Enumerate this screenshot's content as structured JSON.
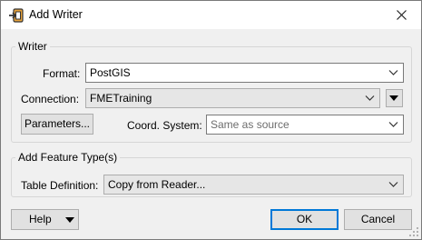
{
  "window": {
    "title": "Add Writer"
  },
  "writer_group": {
    "legend": "Writer",
    "format_label": "Format:",
    "format_value": "PostGIS",
    "connection_label": "Connection:",
    "connection_value": "FMETraining",
    "parameters_button": "Parameters...",
    "coord_label": "Coord. System:",
    "coord_value": "Same as source"
  },
  "feature_group": {
    "legend": "Add Feature Type(s)",
    "table_def_label": "Table Definition:",
    "table_def_value": "Copy from Reader..."
  },
  "footer": {
    "help_button": "Help",
    "ok_button": "OK",
    "cancel_button": "Cancel"
  },
  "icons": {
    "app": "add-writer-icon",
    "close": "close-icon",
    "dropdown": "chevron-down-icon"
  },
  "colors": {
    "dialog_bg": "#f0f0f0",
    "title_bg": "#ffffff",
    "default_button_border": "#0078d7",
    "icon_accent": "#e8a33b"
  }
}
